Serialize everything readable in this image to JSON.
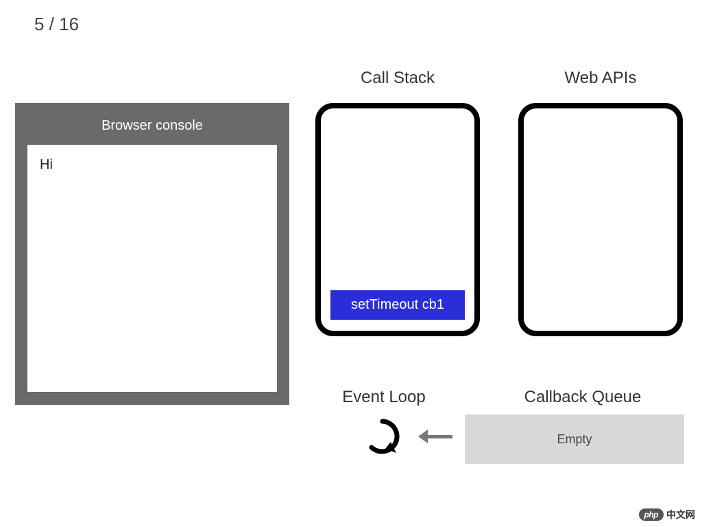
{
  "step": {
    "current": 5,
    "total": 16,
    "display": "5 / 16"
  },
  "console": {
    "title": "Browser console",
    "output": "Hi"
  },
  "labels": {
    "call_stack": "Call Stack",
    "web_apis": "Web APIs",
    "event_loop": "Event Loop",
    "callback_queue": "Callback Queue"
  },
  "call_stack": {
    "frames": [
      "setTimeout cb1"
    ]
  },
  "web_apis": {
    "items": []
  },
  "callback_queue": {
    "state": "Empty",
    "items": []
  },
  "watermark": {
    "badge": "php",
    "text": "中文网"
  }
}
